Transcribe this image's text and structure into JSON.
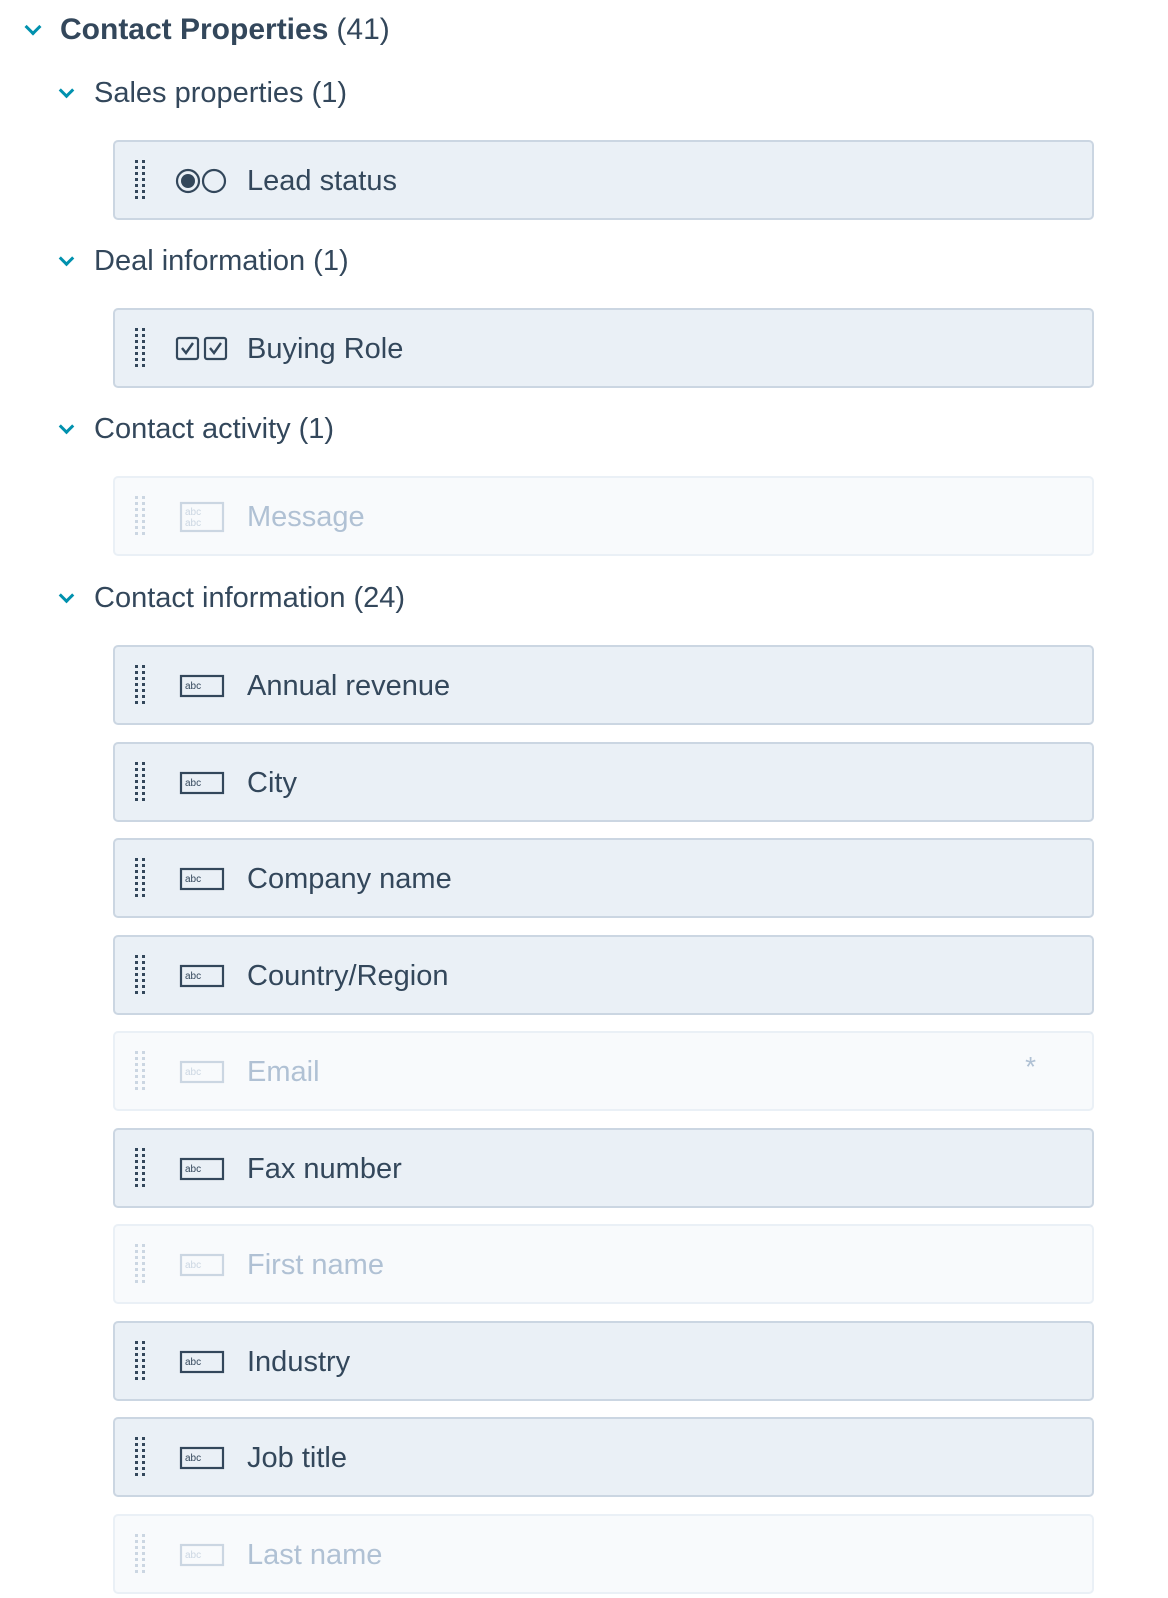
{
  "header": {
    "title": "Contact Properties",
    "count": "(41)"
  },
  "groups": [
    {
      "title": "Sales properties",
      "count": "(1)",
      "items": [
        {
          "label": "Lead status",
          "type_icon": "radio-icon",
          "disabled": false
        }
      ]
    },
    {
      "title": "Deal information",
      "count": "(1)",
      "items": [
        {
          "label": "Buying Role",
          "type_icon": "checkbox-icon",
          "disabled": false
        }
      ]
    },
    {
      "title": "Contact activity",
      "count": "(1)",
      "items": [
        {
          "label": "Message",
          "type_icon": "multiline-text-icon",
          "disabled": true
        }
      ]
    },
    {
      "title": "Contact information",
      "count": "(24)",
      "items": [
        {
          "label": "Annual revenue",
          "type_icon": "text-field-icon",
          "disabled": false
        },
        {
          "label": "City",
          "type_icon": "text-field-icon",
          "disabled": false
        },
        {
          "label": "Company name",
          "type_icon": "text-field-icon",
          "disabled": false
        },
        {
          "label": "Country/Region",
          "type_icon": "text-field-icon",
          "disabled": false
        },
        {
          "label": "Email",
          "type_icon": "text-field-icon",
          "disabled": true,
          "required_mark": "*"
        },
        {
          "label": "Fax number",
          "type_icon": "text-field-icon",
          "disabled": false
        },
        {
          "label": "First name",
          "type_icon": "text-field-icon",
          "disabled": true
        },
        {
          "label": "Industry",
          "type_icon": "text-field-icon",
          "disabled": false
        },
        {
          "label": "Job title",
          "type_icon": "text-field-icon",
          "disabled": false
        },
        {
          "label": "Last name",
          "type_icon": "text-field-icon",
          "disabled": true
        }
      ]
    }
  ],
  "icon_text": {
    "abc": "abc"
  },
  "colors": {
    "accent": "#0091ae",
    "text": "#33475b",
    "card_bg": "#eaf0f6",
    "card_border": "#cbd6e2",
    "disabled_text": "#b0c1d4"
  }
}
